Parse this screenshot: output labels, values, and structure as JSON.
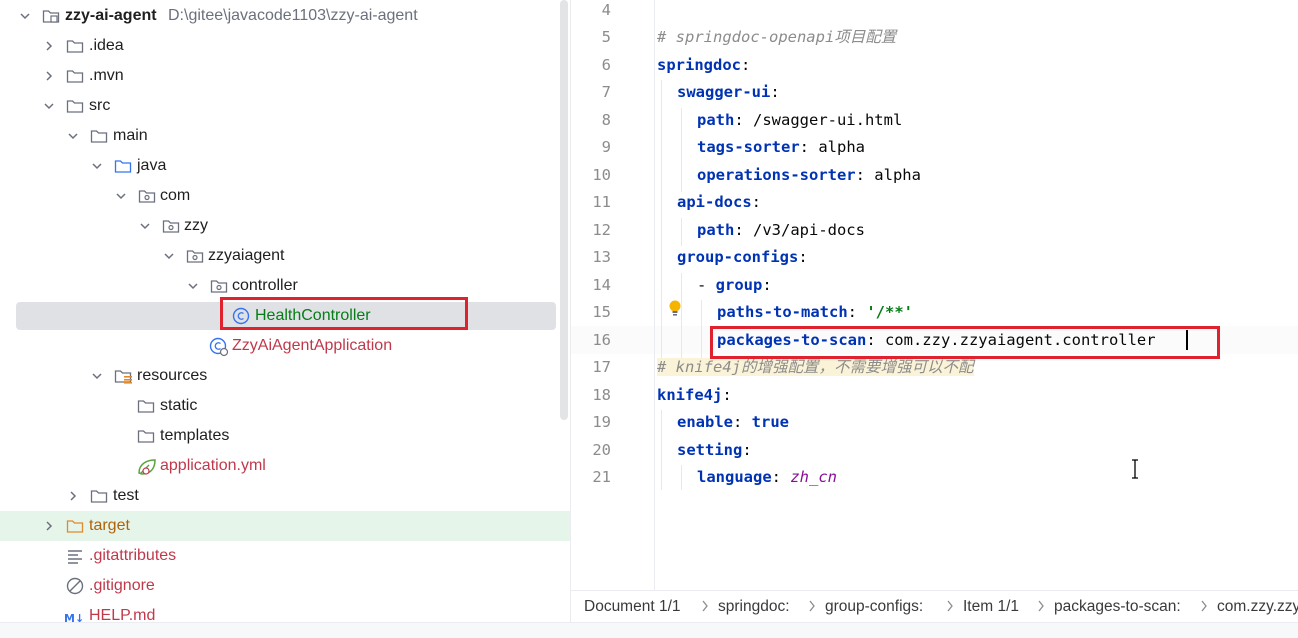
{
  "project_tree": {
    "root": {
      "name": "zzy-ai-agent",
      "path": "D:\\gitee\\javacode1103\\zzy-ai-agent"
    },
    "items": [
      {
        "label": ".idea"
      },
      {
        "label": ".mvn"
      },
      {
        "label": "src"
      },
      {
        "label": "main"
      },
      {
        "label": "java"
      },
      {
        "label": "com"
      },
      {
        "label": "zzy"
      },
      {
        "label": "zzyaiagent"
      },
      {
        "label": "controller"
      },
      {
        "label": "HealthController"
      },
      {
        "label": "ZzyAiAgentApplication"
      },
      {
        "label": "resources"
      },
      {
        "label": "static"
      },
      {
        "label": "templates"
      },
      {
        "label": "application.yml"
      },
      {
        "label": "test"
      },
      {
        "label": "target"
      },
      {
        "label": ".gitattributes"
      },
      {
        "label": ".gitignore"
      },
      {
        "label": "HELP.md"
      }
    ],
    "selected_item": "HealthController"
  },
  "editor": {
    "file_type": "yaml",
    "lines": [
      {
        "num": "4",
        "text": ""
      },
      {
        "num": "5",
        "text": "# springdoc-openapi项目配置"
      },
      {
        "num": "6",
        "key": "springdoc",
        "after": ":"
      },
      {
        "num": "7",
        "key": "swagger-ui",
        "after": ":"
      },
      {
        "num": "8",
        "key": "path",
        "after": ": /swagger-ui.html"
      },
      {
        "num": "9",
        "key": "tags-sorter",
        "after": ": alpha"
      },
      {
        "num": "10",
        "key": "operations-sorter",
        "after": ": alpha"
      },
      {
        "num": "11",
        "key": "api-docs",
        "after": ":"
      },
      {
        "num": "12",
        "key": "path",
        "after": ": /v3/api-docs"
      },
      {
        "num": "13",
        "key": "group-configs",
        "after": ":"
      },
      {
        "num": "14",
        "prefix": "- ",
        "key": "group",
        "after": ":"
      },
      {
        "num": "15",
        "key": "paths-to-match",
        "after": ": ",
        "string": "'/**'"
      },
      {
        "num": "16",
        "key": "packages-to-scan",
        "after": ": com.zzy.zzyaiagent.controller"
      },
      {
        "num": "17",
        "text": "# knife4j的增强配置，不需要增强可以不配"
      },
      {
        "num": "18",
        "key": "knife4j",
        "after": ":"
      },
      {
        "num": "19",
        "key": "enable",
        "after": ": ",
        "bool": "true"
      },
      {
        "num": "20",
        "key": "setting",
        "after": ":"
      },
      {
        "num": "21",
        "key": "language",
        "after": ": ",
        "italic": "zh_cn"
      }
    ]
  },
  "breadcrumb": {
    "items": [
      "Document 1/1",
      "springdoc:",
      "group-configs:",
      "Item 1/1",
      "packages-to-scan:",
      "com.zzy.zzyaiagent.controller"
    ]
  },
  "colors": {
    "annotation_red": "#e0212e",
    "selection_bg": "#dfe1e5",
    "target_row_bg": "#e6f5ea",
    "yaml_key": "#0033b3",
    "yaml_string": "#067d17",
    "comment": "#8c8c8c"
  },
  "icons": {
    "folder": "folder-icon",
    "source_folder": "source-folder-icon",
    "package": "package-icon",
    "class": "class-icon",
    "spring_boot_app": "spring-boot-app-class-icon",
    "resources": "resources-folder-icon",
    "spring_yaml": "spring-yaml-icon",
    "excluded_folder": "excluded-folder-icon",
    "text_file": "text-file-icon",
    "ignore_file": "ignore-file-icon",
    "markdown": "markdown-icon",
    "intention_bulb": "intention-bulb-icon"
  }
}
